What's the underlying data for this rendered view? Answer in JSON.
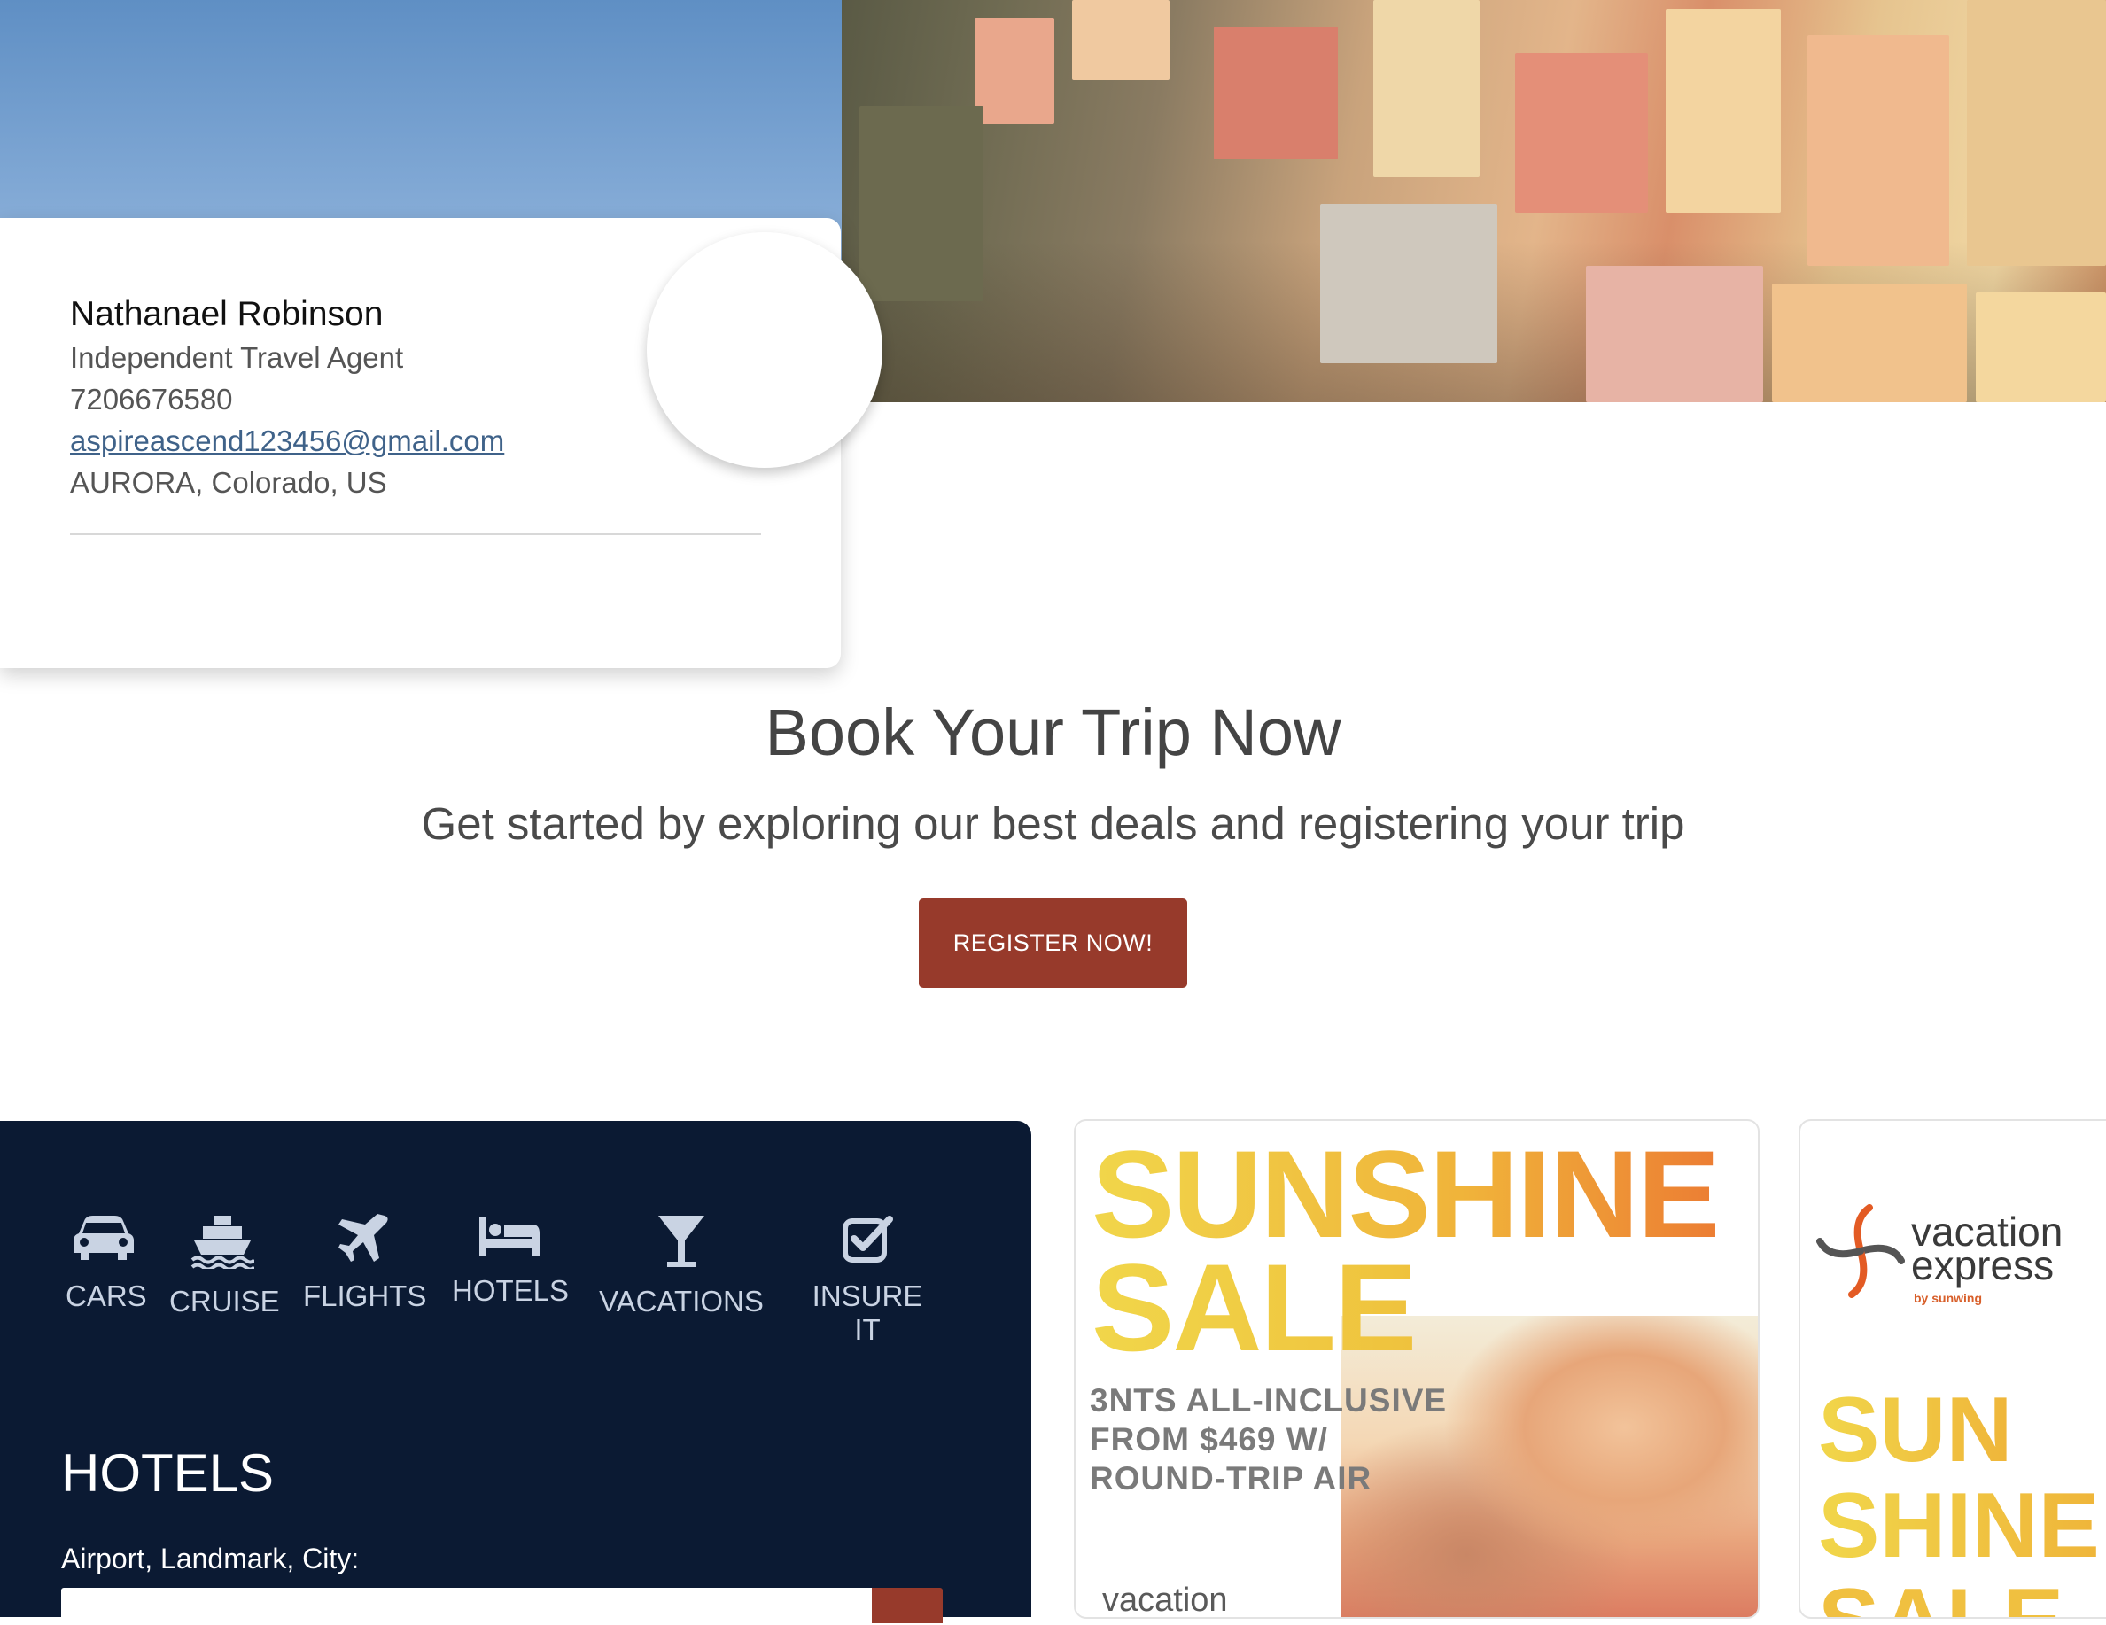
{
  "agent": {
    "name": "Nathanael Robinson",
    "title": "Independent Travel Agent",
    "phone": "7206676580",
    "email": "aspireascend123456@gmail.com",
    "location": "AURORA, Colorado, US"
  },
  "book": {
    "title": "Book Your Trip Now",
    "subtitle": "Get started by exploring our best deals and registering your trip",
    "register_label": "REGISTER NOW!"
  },
  "search": {
    "tabs": [
      {
        "label": "CARS",
        "icon": "car-icon"
      },
      {
        "label": "CRUISE",
        "icon": "cruise-ship-icon"
      },
      {
        "label": "FLIGHTS",
        "icon": "airplane-icon"
      },
      {
        "label": "HOTELS",
        "icon": "bed-icon"
      },
      {
        "label": "VACATIONS",
        "icon": "cocktail-glass-icon"
      },
      {
        "label": "INSURE IT",
        "icon": "checkbox-icon"
      }
    ],
    "active_tab_heading": "HOTELS",
    "field_label": "Airport, Landmark, City:",
    "field_value": ""
  },
  "promos": [
    {
      "headline_line1": "SUNSHINE",
      "headline_line2": "SALE",
      "detail_lines": [
        "3NTS ALL-INCLUSIVE",
        "FROM $469 W/",
        "ROUND-TRIP AIR"
      ],
      "logo_text": "vacation"
    },
    {
      "logo_line1": "vacation",
      "logo_line2": "express",
      "logo_by": "by sunwing",
      "headline_line1": "SUN",
      "headline_line2": "SHINE",
      "headline_line3": "SALE"
    }
  ],
  "colors": {
    "accent": "#973a2b",
    "widget_bg": "#0b1a33",
    "link": "#3f6289",
    "promo_yellow": "#f1d64a",
    "promo_orange": "#ec7d33"
  }
}
